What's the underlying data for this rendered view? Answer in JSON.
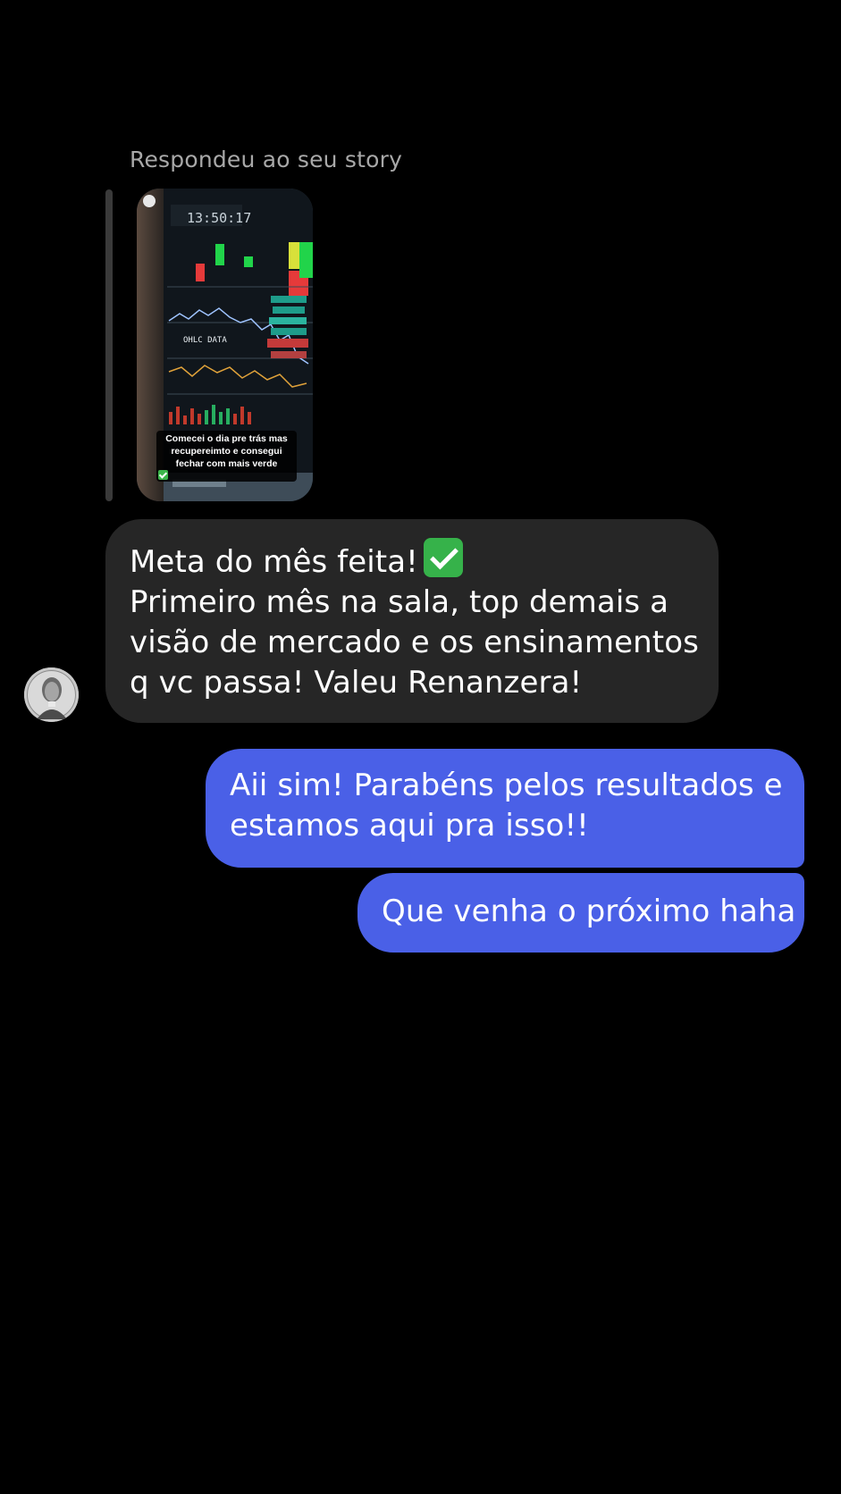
{
  "thread": {
    "reply_label": "Respondeu ao seu story",
    "story": {
      "clock_text": "13:50:17",
      "caption_lines": [
        "Comecei o dia pre trás mas",
        "recupereimto e consegui",
        "fechar com mais verde"
      ],
      "caption_emoji": "check-mark-button"
    },
    "received_message": {
      "lines": [
        "Meta do mês feita!",
        "Primeiro mês na sala, top demais a",
        "visão de mercado e os ensinamentos",
        "q vc passa! Valeu Renanzera!"
      ],
      "emoji": "check-mark-button"
    },
    "sent_messages": [
      {
        "lines": [
          "Aii sim! Parabéns pelos resultados e",
          "estamos aqui pra isso!!"
        ]
      },
      {
        "lines": [
          "Que venha o próximo haha"
        ]
      }
    ]
  },
  "colors": {
    "background": "#000000",
    "received_bubble": "#262626",
    "sent_bubble": "#4a60e7",
    "label_gray": "#a8a8a8",
    "check_green": "#36b24a"
  }
}
